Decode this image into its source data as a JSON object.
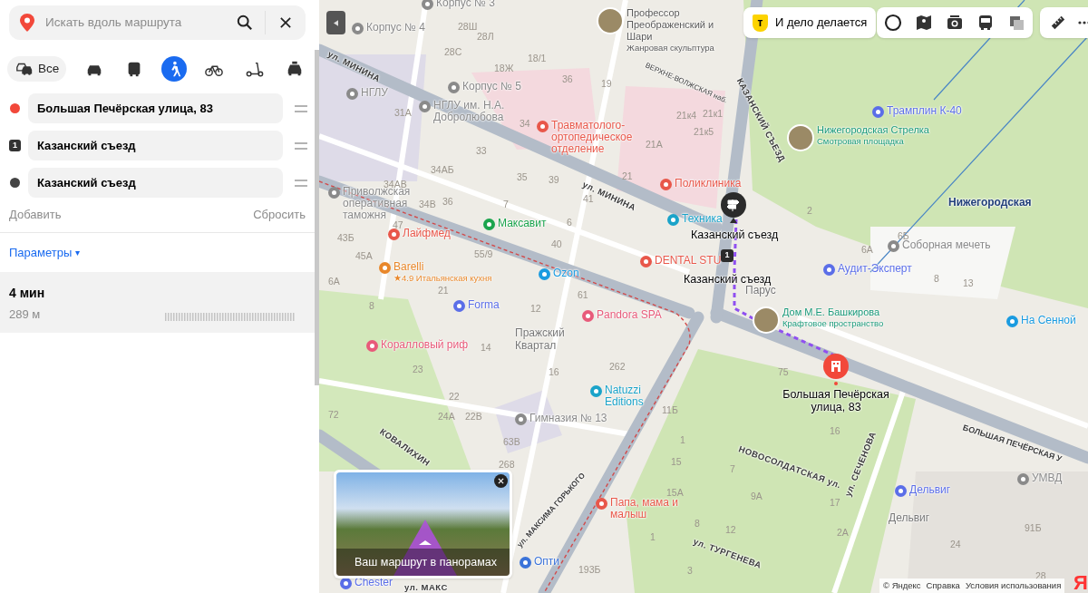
{
  "search": {
    "placeholder": "Искать вдоль маршрута"
  },
  "transport_modes": [
    {
      "kind": "all",
      "label": "Все",
      "selected": false
    },
    {
      "kind": "car",
      "selected": false
    },
    {
      "kind": "bus",
      "selected": false
    },
    {
      "kind": "walk",
      "selected": true
    },
    {
      "kind": "bike",
      "selected": false
    },
    {
      "kind": "scooter",
      "selected": false
    },
    {
      "kind": "taxi",
      "selected": false
    }
  ],
  "waypoints": [
    {
      "kind": "start",
      "value": "Большая Печёрская улица, 83"
    },
    {
      "kind": "via",
      "number": "1",
      "value": "Казанский съезд"
    },
    {
      "kind": "end",
      "value": "Казанский съезд"
    }
  ],
  "add_label": "Добавить",
  "reset_label": "Сбросить",
  "parameters": {
    "label": "Параметры",
    "caret": "▾"
  },
  "route_result": {
    "duration": "4 мин",
    "distance": "289 м"
  },
  "promo": {
    "logo_letter": "т",
    "label": "И дело делается"
  },
  "map": {
    "labels": [
      {
        "kind": "street",
        "text": "ул. МИНИНА"
      },
      {
        "kind": "street",
        "text": "ул. МИНИНА"
      },
      {
        "kind": "street",
        "text": "ВЕРХНЕ-ВОЛЖСКАЯ наб."
      },
      {
        "kind": "street",
        "text": "КАЗАНСКИЙ СЪЕЗД"
      },
      {
        "kind": "street",
        "text": "БОЛЬШАЯ ПЕЧЁРСКАЯ У"
      },
      {
        "kind": "street",
        "text": "НОВОСОЛДАТСКАЯ ул."
      },
      {
        "kind": "street",
        "text": "ул. СЕЧЕНОВА"
      },
      {
        "kind": "street",
        "text": "ул. ТУРГЕНЕВА"
      },
      {
        "kind": "street",
        "text": "ул. МАКСИМА ГОРЬКОГО"
      },
      {
        "kind": "street",
        "text": "КОВАЛИХИН"
      },
      {
        "kind": "street",
        "text": "ул. МАКС"
      },
      {
        "kind": "photo_poi",
        "text": "Профессор Преображенский и Шари",
        "subtitle": "Жанровая скульптура",
        "color": "#5a5a5a"
      },
      {
        "kind": "poi",
        "text": "Корпус № 3",
        "color": "#8a8a8a"
      },
      {
        "kind": "poi",
        "text": "Корпус № 4",
        "color": "#8a8a8a"
      },
      {
        "kind": "poi",
        "text": "НГЛУ",
        "color": "#8a8a8a"
      },
      {
        "kind": "poi",
        "text": "Корпус № 5",
        "color": "#8a8a8a"
      },
      {
        "kind": "poi",
        "text": "НГЛУ им. Н.А. Добролюбова",
        "color": "#8a8a8a"
      },
      {
        "kind": "poi",
        "text": "Травматолого-ортопедическое отделение",
        "color": "#e8574a"
      },
      {
        "kind": "poi",
        "text": "Поликлиника",
        "color": "#e8574a"
      },
      {
        "kind": "poi",
        "text": "Приволжская оперативная таможня",
        "color": "#8a8a8a"
      },
      {
        "kind": "poi",
        "text": "Максавит",
        "color": "#1ba44d"
      },
      {
        "kind": "poi",
        "text": "Лайфмед",
        "color": "#e8574a"
      },
      {
        "kind": "poi",
        "text": "Barelli",
        "subtitle": "★4.9 Итальянская кухня",
        "color": "#e8872a"
      },
      {
        "kind": "poi",
        "text": "Ozon",
        "color": "#1a9be0"
      },
      {
        "kind": "poi",
        "text": "Техника",
        "color": "#1aa3c9"
      },
      {
        "kind": "poi",
        "text": "DENTAL STU",
        "color": "#e8574a"
      },
      {
        "kind": "poi",
        "text": "Forma",
        "color": "#5b6ee8"
      },
      {
        "kind": "poi",
        "text": "Pandora SPA",
        "color": "#e85a7a"
      },
      {
        "kind": "poi",
        "text": "Коралловый риф",
        "color": "#e85a7a"
      },
      {
        "kind": "place",
        "text": "Пражский Квартал"
      },
      {
        "kind": "poi",
        "text": "Natuzzi Editions",
        "color": "#1aa3c9"
      },
      {
        "kind": "poi",
        "text": "Гимназия № 13",
        "color": "#8a8a8a"
      },
      {
        "kind": "poi",
        "text": "Папа, мама и малыш",
        "color": "#e8574a"
      },
      {
        "kind": "poi",
        "text": "Опти",
        "color": "#3b73d9"
      },
      {
        "kind": "poi",
        "text": "Chester",
        "color": "#5b6ee8"
      },
      {
        "kind": "photo_poi",
        "text": "Нижегородская Стрелка",
        "subtitle": "Смотровая площадка",
        "color": "#1a9a7a"
      },
      {
        "kind": "poi",
        "text": "Трамплин К-40",
        "color": "#5b6ee8"
      },
      {
        "kind": "metro",
        "text": "Нижегородская",
        "color": "#23407a"
      },
      {
        "kind": "poi",
        "text": "Соборная мечеть",
        "color": "#8a8a8a"
      },
      {
        "kind": "poi",
        "text": "Аудит-Эксперт",
        "color": "#5b6ee8"
      },
      {
        "kind": "place",
        "text": "Парус"
      },
      {
        "kind": "photo_poi",
        "text": "Дом М.Е. Башкирова",
        "subtitle": "Крафтовое пространство",
        "color": "#1a9a7a"
      },
      {
        "kind": "poi",
        "text": "На Сенной",
        "color": "#1a9be0"
      },
      {
        "kind": "poi",
        "text": "УМВД",
        "color": "#8a8a8a"
      },
      {
        "kind": "poi",
        "text": "Дельвиг",
        "color": "#5b6ee8"
      },
      {
        "kind": "place",
        "text": "Дельвиг"
      },
      {
        "kind": "house",
        "text": "28Ш"
      },
      {
        "kind": "house",
        "text": "28Л"
      },
      {
        "kind": "house",
        "text": "28С"
      },
      {
        "kind": "house",
        "text": "18/1"
      },
      {
        "kind": "house",
        "text": "18Ж"
      },
      {
        "kind": "house",
        "text": "36"
      },
      {
        "kind": "house",
        "text": "19"
      },
      {
        "kind": "house",
        "text": "21к4"
      },
      {
        "kind": "house",
        "text": "21к5"
      },
      {
        "kind": "house",
        "text": "21А"
      },
      {
        "kind": "house",
        "text": "21"
      },
      {
        "kind": "house",
        "text": "34"
      },
      {
        "kind": "house",
        "text": "33"
      },
      {
        "kind": "house",
        "text": "35"
      },
      {
        "kind": "house",
        "text": "39"
      },
      {
        "kind": "house",
        "text": "41"
      },
      {
        "kind": "house",
        "text": "7"
      },
      {
        "kind": "house",
        "text": "6"
      },
      {
        "kind": "house",
        "text": "40"
      },
      {
        "kind": "house",
        "text": "31А"
      },
      {
        "kind": "house",
        "text": "34АБ"
      },
      {
        "kind": "house",
        "text": "34АВ"
      },
      {
        "kind": "house",
        "text": "34В"
      },
      {
        "kind": "house",
        "text": "36"
      },
      {
        "kind": "house",
        "text": "47"
      },
      {
        "kind": "house",
        "text": "43Б"
      },
      {
        "kind": "house",
        "text": "45А"
      },
      {
        "kind": "house",
        "text": "55/9"
      },
      {
        "kind": "house",
        "text": "6А"
      },
      {
        "kind": "house",
        "text": "21"
      },
      {
        "kind": "house",
        "text": "61"
      },
      {
        "kind": "house",
        "text": "8"
      },
      {
        "kind": "house",
        "text": "12"
      },
      {
        "kind": "house",
        "text": "14"
      },
      {
        "kind": "house",
        "text": "23"
      },
      {
        "kind": "house",
        "text": "16"
      },
      {
        "kind": "house",
        "text": "262"
      },
      {
        "kind": "house",
        "text": "22"
      },
      {
        "kind": "house",
        "text": "24А"
      },
      {
        "kind": "house",
        "text": "22В"
      },
      {
        "kind": "house",
        "text": "63В"
      },
      {
        "kind": "house",
        "text": "72"
      },
      {
        "kind": "house",
        "text": "11Б"
      },
      {
        "kind": "house",
        "text": "1"
      },
      {
        "kind": "house",
        "text": "15"
      },
      {
        "kind": "house",
        "text": "15А"
      },
      {
        "kind": "house",
        "text": "8"
      },
      {
        "kind": "house",
        "text": "268"
      },
      {
        "kind": "house",
        "text": "1"
      },
      {
        "kind": "house",
        "text": "3"
      },
      {
        "kind": "house",
        "text": "193Б"
      },
      {
        "kind": "house",
        "text": "21к1"
      },
      {
        "kind": "house",
        "text": "2"
      },
      {
        "kind": "house",
        "text": "6Б"
      },
      {
        "kind": "house",
        "text": "6А"
      },
      {
        "kind": "house",
        "text": "8"
      },
      {
        "kind": "house",
        "text": "13"
      },
      {
        "kind": "house",
        "text": "75"
      },
      {
        "kind": "house",
        "text": "16"
      },
      {
        "kind": "house",
        "text": "7"
      },
      {
        "kind": "house",
        "text": "9А"
      },
      {
        "kind": "house",
        "text": "17"
      },
      {
        "kind": "house",
        "text": "2А"
      },
      {
        "kind": "house",
        "text": "91Б"
      },
      {
        "kind": "house",
        "text": "24"
      },
      {
        "kind": "house",
        "text": "28"
      },
      {
        "kind": "house",
        "text": "12"
      }
    ],
    "route_labels": [
      {
        "text": "Казанский съезд"
      },
      {
        "text": "Казанский съезд"
      },
      {
        "text": "Большая Печёрская улица, 83"
      }
    ],
    "via_marker": {
      "number": "1"
    }
  },
  "panorama": {
    "caption": "Ваш маршрут в панорамах"
  },
  "footer": {
    "links": [
      "© Яндекс",
      "Справка",
      "Условия использования"
    ],
    "logo": "Я"
  }
}
